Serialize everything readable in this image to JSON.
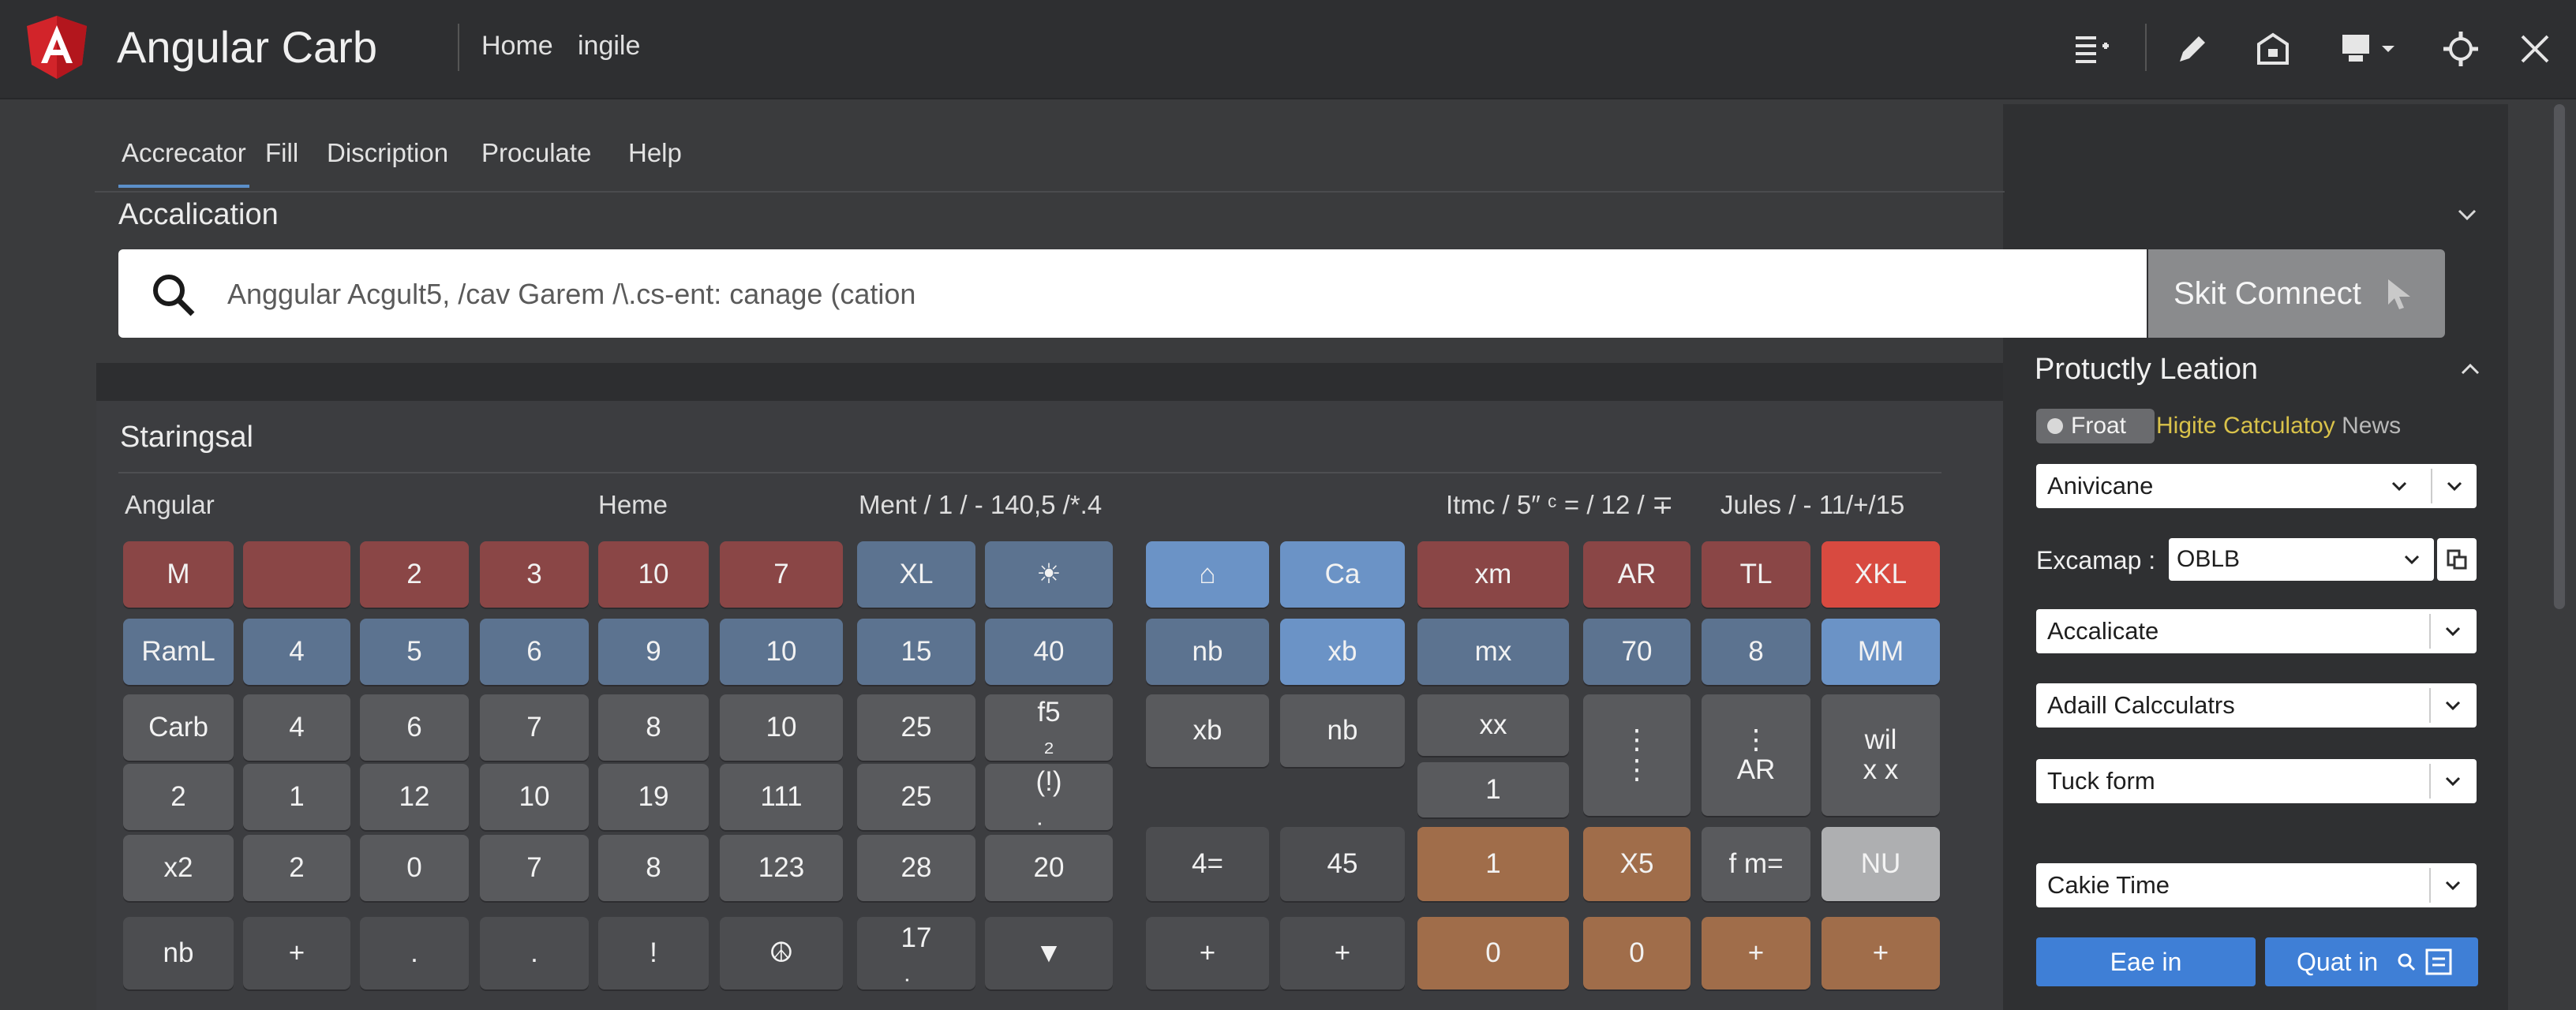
{
  "app": {
    "title": "Angular Carb",
    "breadcrumbs": [
      "Home",
      "ingile"
    ]
  },
  "toolbar_icons": [
    "list-add-icon",
    "pen-icon",
    "briefcase-icon",
    "monitor-icon",
    "gear-icon",
    "close-icon"
  ],
  "menu": {
    "items": [
      "Accrecator",
      "Fill",
      "Discription",
      "Proculate",
      "Help"
    ],
    "active": 0
  },
  "accalication": {
    "title": "Accalication",
    "search_placeholder": "Anggular Acgult5, /cav Garem /\\.cs-ent: canage (cation",
    "connect_label": "Skit Comnect"
  },
  "calculator": {
    "title": "Staringsal",
    "column_labels": {
      "angular": "Angular",
      "heme": "Heme",
      "ment": "Ment  / 1 / - 140,5 /*.4",
      "itmc": "Itmc /   5″ ᶜ  = / 12 / ∓",
      "jules": "Jules / - 11/+/15"
    },
    "keys": {
      "r1": [
        "M",
        "",
        "2",
        "3",
        "10",
        "7",
        "XL",
        "☀",
        "⌂",
        "Ca",
        "xm",
        "AR",
        "TL",
        "XKL"
      ],
      "r2": [
        "RamL",
        "4",
        "5",
        "6",
        "9",
        "10",
        "15",
        "40",
        "nb",
        "xb",
        "mx",
        "70",
        "8",
        "MM"
      ],
      "r3": [
        "Carb",
        "4",
        "6",
        "7",
        "8",
        "10",
        "25",
        "f5\n₂",
        "xb",
        "nb",
        "xx",
        "⋮\n⋮",
        "⋮\nAR",
        "wil\nx x"
      ],
      "r4": [
        "2",
        "1",
        "12",
        "10",
        "19",
        "111",
        "25",
        "(!)\ṇ",
        "1"
      ],
      "r5": [
        "x2",
        "2",
        "0",
        "7",
        "8",
        "123",
        "28",
        "20",
        "4=",
        "45",
        "1",
        "X5",
        "f m=",
        "NU"
      ],
      "r6": [
        "nb",
        "+",
        ".",
        ".",
        "!",
        "☮",
        "17\ṇ",
        "▼",
        "+",
        "+",
        "0",
        "0",
        "+",
        "+"
      ]
    }
  },
  "sidebar": {
    "title": "Protuctly Leation",
    "toggle_label": "Froat",
    "news_highlight": "Higite Catculatoy",
    "news_suffix": "News",
    "select1": "Anivicane",
    "example_label": "Excamap :",
    "example_value": "OBLB",
    "select2": "Accalicate",
    "select3": "Adaill Calcculatrs",
    "select4": "Tuck form",
    "select5": "Cakie Time",
    "btn1": "Eae in",
    "btn2": "Quat in",
    "colors": {
      "accent": "#3f7fd6",
      "news_yellow": "#d9c24a"
    }
  }
}
